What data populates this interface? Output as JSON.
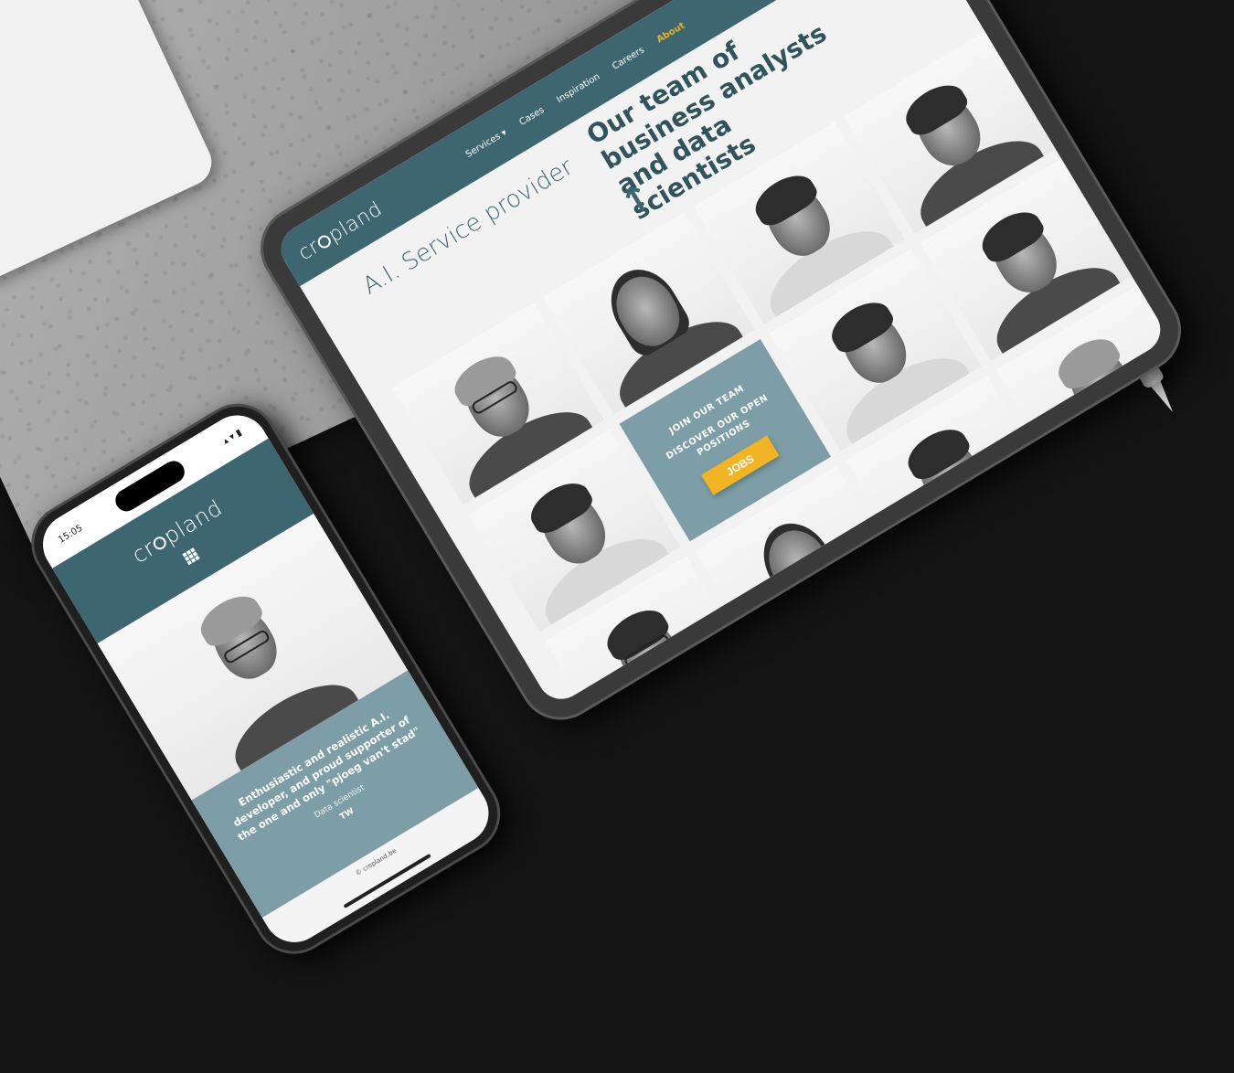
{
  "tablet": {
    "logo": {
      "prefix": "cr",
      "suffix": "pland"
    },
    "nav": [
      "Services",
      "Cases",
      "Inspiration",
      "Careers",
      "About"
    ],
    "nav_services_caret": "▾",
    "search_icon": "search-icon",
    "subtitle": "A.I. Service provider",
    "title": "Our team of business analysts and data scientists",
    "arrow": "↑",
    "join": {
      "heading": "JOIN OUR TEAM",
      "text": "DISCOVER OUR OPEN POSITIONS",
      "button": "JOBS"
    }
  },
  "phone": {
    "status": {
      "time": "15:05",
      "indicators": "▴ ▾ ▮"
    },
    "logo": {
      "prefix": "cr",
      "suffix": "pland"
    },
    "menu_icon": "grid-menu-icon",
    "quote": {
      "text": "Enthusiastic and realistic A.I. developer, and proud supporter of the one and only \"pjoeg van't stad\"",
      "role": "Data scientist",
      "initials": "TW"
    },
    "footer": "© cropland.be"
  },
  "colors": {
    "brand": "#3d6671",
    "brand_light": "#7d9ea6",
    "accent": "#f0b424"
  }
}
